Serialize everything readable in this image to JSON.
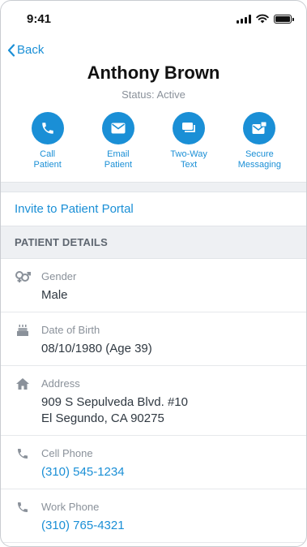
{
  "status_bar": {
    "time": "9:41"
  },
  "header": {
    "back_label": "Back",
    "name": "Anthony Brown",
    "status": "Status: Active"
  },
  "actions": [
    {
      "icon": "phone-icon",
      "label": "Call\nPatient"
    },
    {
      "icon": "email-icon",
      "label": "Email\nPatient"
    },
    {
      "icon": "chat-icon",
      "label": "Two-Way\nText"
    },
    {
      "icon": "secure-message-icon",
      "label": "Secure\nMessaging"
    }
  ],
  "portal": {
    "label": "Invite to Patient Portal"
  },
  "details": {
    "section_title": "PATIENT DETAILS",
    "gender": {
      "label": "Gender",
      "value": "Male"
    },
    "dob": {
      "label": "Date of Birth",
      "value": "08/10/1980 (Age 39)"
    },
    "address": {
      "label": "Address",
      "line1": "909 S Sepulveda Blvd. #10",
      "line2": "El Segundo, CA 90275"
    },
    "cell": {
      "label": "Cell Phone",
      "value": "(310) 545-1234"
    },
    "work": {
      "label": "Work Phone",
      "value": "(310) 765-4321"
    }
  },
  "colors": {
    "accent": "#1a8fd6",
    "muted": "#8a919a",
    "band": "#eef0f3"
  }
}
